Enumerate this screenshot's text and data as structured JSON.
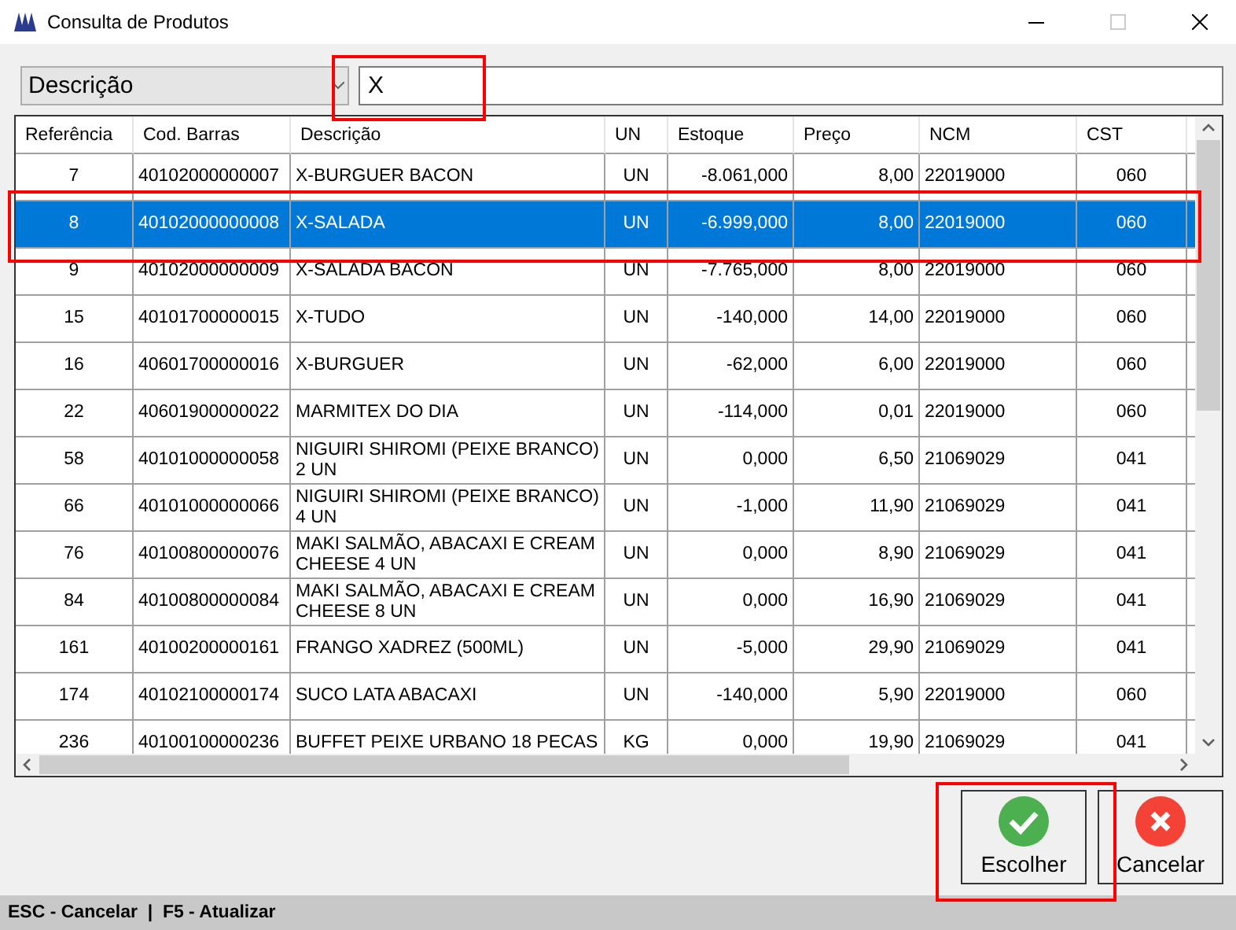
{
  "window": {
    "title": "Consulta de Produtos"
  },
  "filter": {
    "field": "Descrição",
    "search_value": "X",
    "highlighted": true
  },
  "table": {
    "columns": [
      "Referência",
      "Cod. Barras",
      "Descrição",
      "UN",
      "Estoque",
      "Preço",
      "NCM",
      "CST"
    ],
    "rows": [
      {
        "cells": [
          "7",
          "40102000000007",
          "X-BURGUER BACON",
          "UN",
          "-8.061,000",
          "8,00",
          "22019000",
          "060"
        ],
        "selected": false
      },
      {
        "cells": [
          "8",
          "40102000000008",
          "X-SALADA",
          "UN",
          "-6.999,000",
          "8,00",
          "22019000",
          "060"
        ],
        "selected": true,
        "highlighted": true
      },
      {
        "cells": [
          "9",
          "40102000000009",
          "X-SALADA BACON",
          "UN",
          "-7.765,000",
          "8,00",
          "22019000",
          "060"
        ],
        "selected": false
      },
      {
        "cells": [
          "15",
          "40101700000015",
          "X-TUDO",
          "UN",
          "-140,000",
          "14,00",
          "22019000",
          "060"
        ],
        "selected": false
      },
      {
        "cells": [
          "16",
          "40601700000016",
          "X-BURGUER",
          "UN",
          "-62,000",
          "6,00",
          "22019000",
          "060"
        ],
        "selected": false
      },
      {
        "cells": [
          "22",
          "40601900000022",
          "MARMITEX DO DIA",
          "UN",
          "-114,000",
          "0,01",
          "22019000",
          "060"
        ],
        "selected": false
      },
      {
        "cells": [
          "58",
          "40101000000058",
          "NIGUIRI SHIROMI (PEIXE BRANCO) 2 UN",
          "UN",
          "0,000",
          "6,50",
          "21069029",
          "041"
        ],
        "selected": false
      },
      {
        "cells": [
          "66",
          "40101000000066",
          "NIGUIRI SHIROMI (PEIXE BRANCO) 4 UN",
          "UN",
          "-1,000",
          "11,90",
          "21069029",
          "041"
        ],
        "selected": false
      },
      {
        "cells": [
          "76",
          "40100800000076",
          "MAKI SALMÃO, ABACAXI E CREAM CHEESE 4 UN",
          "UN",
          "0,000",
          "8,90",
          "21069029",
          "041"
        ],
        "selected": false
      },
      {
        "cells": [
          "84",
          "40100800000084",
          "MAKI SALMÃO, ABACAXI E CREAM CHEESE 8 UN",
          "UN",
          "0,000",
          "16,90",
          "21069029",
          "041"
        ],
        "selected": false
      },
      {
        "cells": [
          "161",
          "40100200000161",
          "FRANGO XADREZ (500ML)",
          "UN",
          "-5,000",
          "29,90",
          "21069029",
          "041"
        ],
        "selected": false
      },
      {
        "cells": [
          "174",
          "40102100000174",
          "SUCO LATA ABACAXI",
          "UN",
          "-140,000",
          "5,90",
          "22019000",
          "060"
        ],
        "selected": false
      },
      {
        "cells": [
          "236",
          "40100100000236",
          "BUFFET PEIXE URBANO 18 PECAS",
          "KG",
          "0,000",
          "19,90",
          "21069029",
          "041"
        ],
        "selected": false
      }
    ]
  },
  "buttons": [
    {
      "kind": "confirm",
      "label": "Escolher",
      "highlighted": true
    },
    {
      "kind": "cancel",
      "label": "Cancelar"
    }
  ],
  "status_bar": "ESC - Cancelar  |  F5 - Atualizar"
}
